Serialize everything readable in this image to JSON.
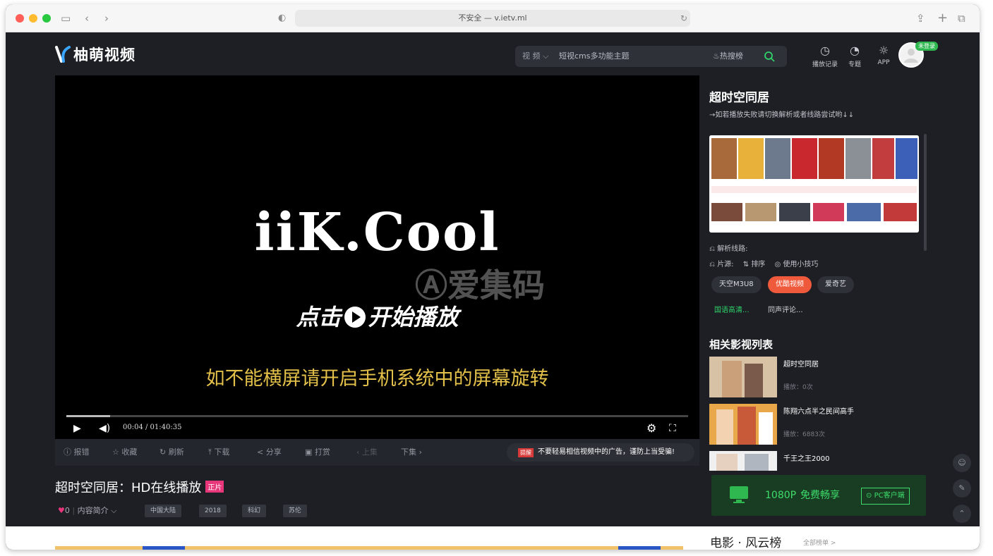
{
  "browser": {
    "address": "不安全 — v.ietv.ml"
  },
  "header": {
    "logo_text": "柚萌视频",
    "search_category": "视 频",
    "search_query": "短视cms多功能主题",
    "hot_search": "热搜榜",
    "nav": [
      {
        "label": "播放记录",
        "icon": "clock-icon"
      },
      {
        "label": "专题",
        "icon": "topic-icon"
      },
      {
        "label": "APP",
        "icon": "app-icon"
      }
    ],
    "login_badge": "未登录"
  },
  "player": {
    "brand": "iiK.Cool",
    "start_prefix": "点击",
    "start_suffix": "开始播放",
    "watermark": "爱集码",
    "hint": "如不能横屏请开启手机系统中的屏幕旋转",
    "time": "00:04 / 01:40:35",
    "progress": 0.07
  },
  "actions": {
    "items": [
      "报错",
      "收藏",
      "刷新",
      "下载",
      "分享",
      "打赏",
      "上集",
      "下集"
    ],
    "warning_tag": "提醒",
    "warning_text": "不要轻易相信视频中的广告，谨防上当受骗!"
  },
  "video": {
    "title": "超时空同居：HD在线播放",
    "tag": "正片",
    "likes": "0",
    "intro": "内容简介",
    "chips": [
      "中国大陆",
      "2018",
      "科幻",
      "苏伦"
    ]
  },
  "sidebar": {
    "title": "超时空同居",
    "subtitle": "→如若播放失败请切换解析或者线路尝试哟↓↓",
    "parse_label": "解析线路:",
    "source_label": "片源:",
    "sort_label": "排序",
    "tips_label": "使用小技巧",
    "sources": [
      "天空M3U8",
      "优酷视频",
      "爱奇艺"
    ],
    "active_source": "优酷视频",
    "segments": [
      "国语高清...",
      "同声评论..."
    ],
    "related_title": "相关影视列表",
    "related": [
      {
        "name": "超时空同居",
        "plays": "播放：0次"
      },
      {
        "name": "陈翔六点半之民间高手",
        "plays": "播放：6883次"
      },
      {
        "name": "千王之王2000",
        "plays": ""
      }
    ],
    "promo_quality": "1080P",
    "promo_text": "免费畅享",
    "promo_button": "PC客户端"
  },
  "ranking": {
    "title": "电影 · 风云榜",
    "more": "全部榜单 >"
  },
  "colors": {
    "accent": "#f05a3c",
    "green": "#2fb84f",
    "hint_yellow": "#e3c04a"
  }
}
